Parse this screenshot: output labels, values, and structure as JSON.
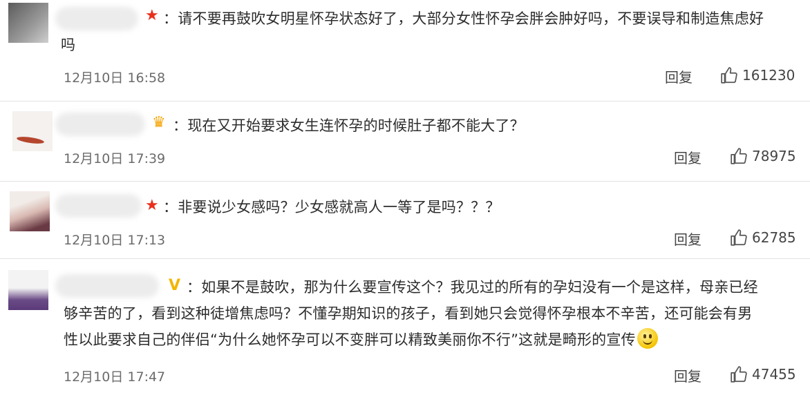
{
  "comments": [
    {
      "badge": "star",
      "text": "：请不要再鼓吹女明星怀孕状态好了，大部分女性怀孕会胖会肿好吗，不要误导和制造焦虑好吗",
      "line1": "：请不要再鼓吹女明星怀孕状态好了，大部分女性怀孕会胖会肿好吗，不要误导和制造焦虑好",
      "line2": "吗",
      "time": "12月10日 16:58",
      "reply": "回复",
      "likes": "161230"
    },
    {
      "badge": "crown",
      "text": "：现在又开始要求女生连怀孕的时候肚子都不能大了？",
      "time": "12月10日 17:39",
      "reply": "回复",
      "likes": "78975"
    },
    {
      "badge": "star",
      "text": "：非要说少女感吗？少女感就高人一等了是吗？？？",
      "time": "12月10日 17:13",
      "reply": "回复",
      "likes": "62785"
    },
    {
      "badge": "v",
      "line1": "：如果不是鼓吹，那为什么要宣传这个？我见过的所有的孕妇没有一个是这样，母亲已经",
      "line2": "够辛苦的了，看到这种徒增焦虑吗？不懂孕期知识的孩子，看到她只会觉得怀孕根本不辛苦，还可能会有男",
      "line3": "性以此要求自己的伴侣“为什么她怀孕可以不变胖可以精致美丽你不行”这就是畸形的宣传",
      "emoji": "smile-emoji",
      "time": "12月10日 17:47",
      "reply": "回复",
      "likes": "47455"
    }
  ],
  "colors": {
    "star": "#e8301c",
    "v": "#f2b600",
    "crown": "#f5a300"
  }
}
